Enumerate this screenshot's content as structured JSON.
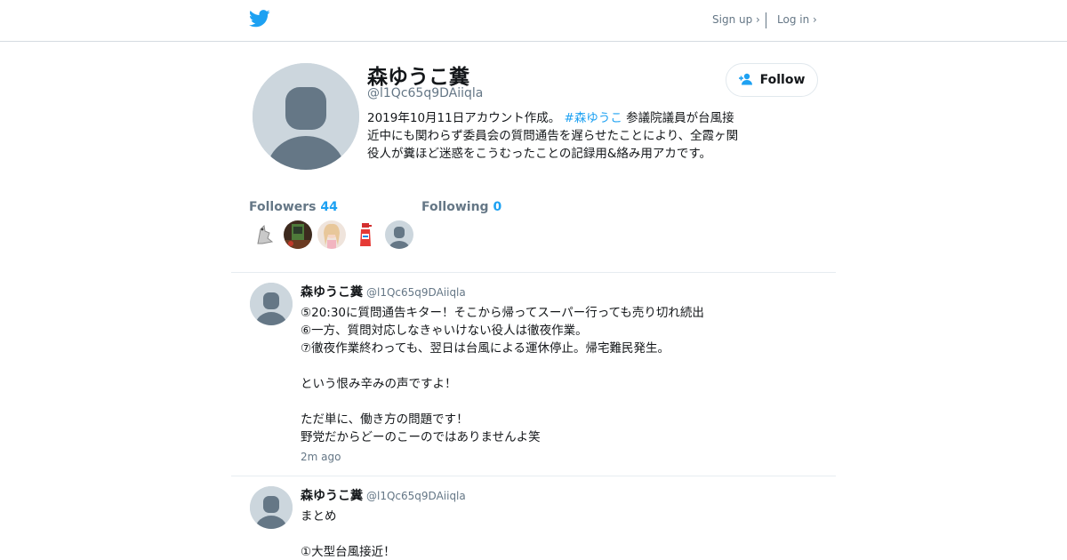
{
  "header": {
    "logo_icon": "twitter-bird-icon",
    "signup_label": "Sign up ›",
    "login_label": "Log in ›"
  },
  "colors": {
    "accent": "#1da1f2",
    "muted": "#657786",
    "avatar_bg": "#ccd6dd"
  },
  "profile": {
    "display_name": "森ゆうこ糞",
    "handle": "@l1Qc65q9DAiiqla",
    "bio_before": "2019年10月11日アカウント作成。 ",
    "bio_hashtag": "#森ゆうこ",
    "bio_after": " 参議院議員が台風接近中にも関わらず委員会の質問通告を遅らせたことにより、全霞ヶ関役人が糞ほど迷惑をこうむったことの記録用&絡み用アカです。",
    "follow_label": "Follow",
    "followers_label": "Followers",
    "followers_count": "44",
    "following_label": "Following",
    "following_count": "0"
  },
  "tweets": [
    {
      "name": "森ゆうこ糞",
      "handle": "@l1Qc65q9DAiiqla",
      "lines": [
        "⑤20:30に質問通告キター！そこから帰ってスーパー行っても売り切れ続出",
        "⑥一方、質問対応しなきゃいけない役人は徹夜作業。",
        "⑦徹夜作業終わっても、翌日は台風による運休停止。帰宅難民発生。",
        "",
        "という恨み辛みの声ですよ！",
        "",
        "ただ単に、働き方の問題です！",
        "野党だからどーのこーのではありませんよ笑"
      ],
      "time": "2m ago"
    },
    {
      "name": "森ゆうこ糞",
      "handle": "@l1Qc65q9DAiiqla",
      "lines": [
        "まとめ",
        "",
        "①大型台風接近！"
      ]
    }
  ]
}
